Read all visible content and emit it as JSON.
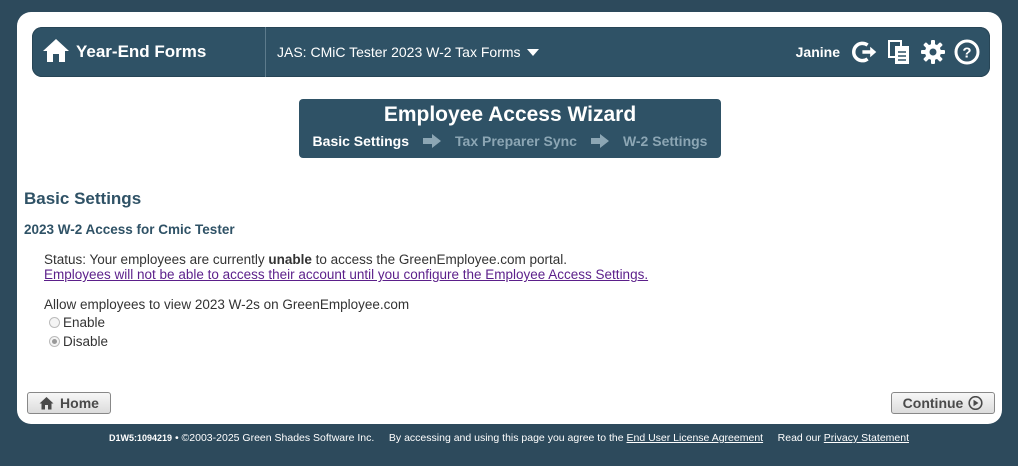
{
  "header": {
    "app_title": "Year-End Forms",
    "form_selector": "JAS: CMiC Tester 2023 W-2 Tax Forms",
    "user_name": "Janine",
    "icons": [
      "home-icon",
      "logout-icon",
      "copy-icon",
      "gear-icon",
      "help-icon"
    ]
  },
  "wizard": {
    "title": "Employee Access Wizard",
    "steps": [
      {
        "label": "Basic Settings",
        "active": true
      },
      {
        "label": "Tax Preparer Sync",
        "active": false
      },
      {
        "label": "W-2 Settings",
        "active": false
      }
    ]
  },
  "main": {
    "section_title": "Basic Settings",
    "subsection_title": "2023 W-2 Access for Cmic Tester",
    "status_prefix": "Status: Your employees are currently ",
    "status_emphasis": "unable",
    "status_suffix": " to access the GreenEmployee.com portal.",
    "status_link": "Employees will not be able to access their account until you configure the Employee Access Settings.",
    "allow_label": "Allow employees to view 2023 W-2s on GreenEmployee.com",
    "options": [
      {
        "label": "Enable",
        "selected": false
      },
      {
        "label": "Disable",
        "selected": true
      }
    ]
  },
  "buttons": {
    "home": "Home",
    "continue": "Continue"
  },
  "footer": {
    "code": "D1W5:1094219",
    "copyright": " • ©2003-2025 Green Shades Software Inc.",
    "agree_text": "By accessing and using this page you agree to the ",
    "eula_link": "End User License Agreement",
    "privacy_prefix": "Read our ",
    "privacy_link": "Privacy Statement"
  },
  "colors": {
    "background": "#2d4a5c",
    "header": "#2f5266",
    "link": "#5b1f8a"
  }
}
